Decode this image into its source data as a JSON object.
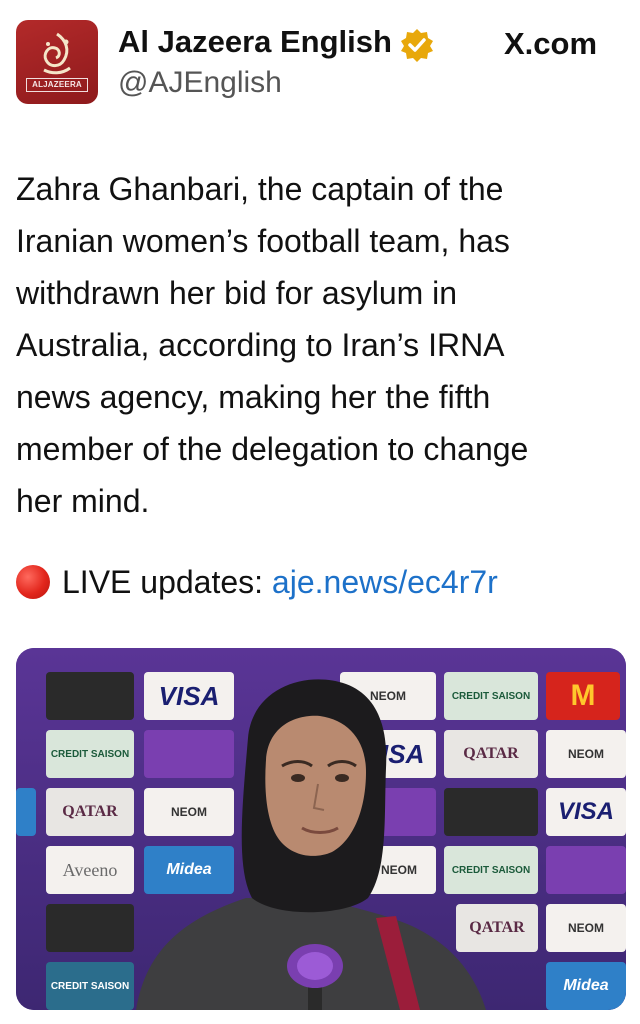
{
  "header": {
    "account_name": "Al Jazeera English",
    "handle": "@AJEnglish",
    "source": "X.com",
    "avatar_caption": "ALJAZEERA",
    "verified_icon": "verified-badge-icon",
    "colors": {
      "avatar": "#a32224",
      "verified": "#e8a80b",
      "link": "#1d71c9"
    }
  },
  "tweet": {
    "text": "Zahra Ghanbari, the captain of the\nIranian women’s football team, has\nwithdrawn her bid for asylum in\nAustralia, according to Iran’s IRNA\nnews agency, making her the fifth\nmember of the delegation to change\nher mind.",
    "live_icon": "red-circle-icon",
    "live_label": "LIVE updates:",
    "live_link": "aje.news/ec4r7r"
  },
  "media": {
    "sponsor_labels": [
      "VISA",
      "QATAR",
      "NEOM",
      "M",
      "Aveeno",
      "Midea",
      "CREDIT SAISON"
    ]
  }
}
